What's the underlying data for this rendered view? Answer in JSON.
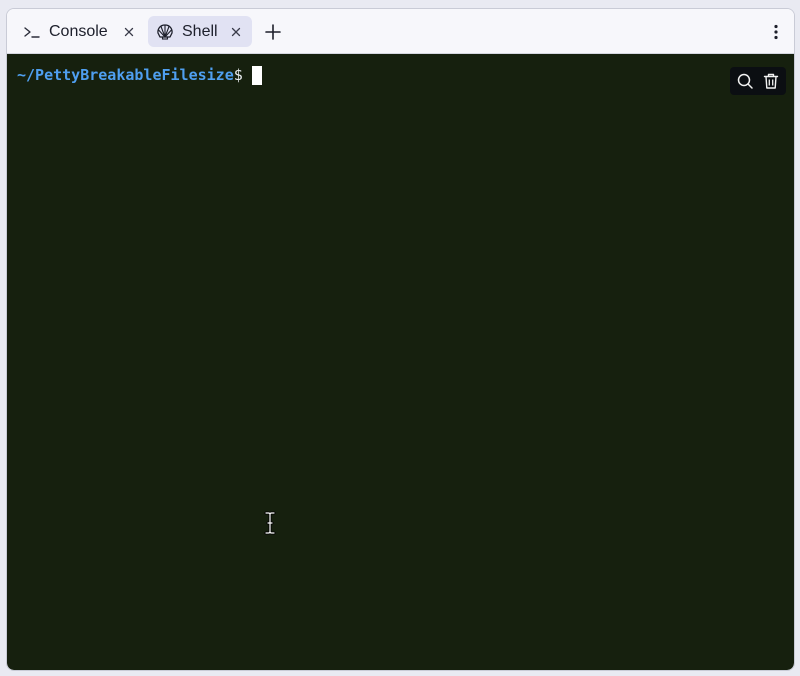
{
  "tabs": [
    {
      "label": "Console",
      "icon": "terminal-prompt-icon",
      "active": false
    },
    {
      "label": "Shell",
      "icon": "shell-icon",
      "active": true
    }
  ],
  "tabbar": {
    "add_icon": "plus-icon",
    "more_icon": "vertical-ellipsis-icon"
  },
  "terminal": {
    "prompt_path": "~/PettyBreakableFilesize",
    "prompt_symbol": "$",
    "background": "#16200e",
    "path_color": "#4f9ff0",
    "tools": [
      "search-icon",
      "trash-icon"
    ]
  },
  "colors": {
    "active_tab_bg": "#e1e2f3",
    "chrome_bg": "#f7f7fb"
  }
}
